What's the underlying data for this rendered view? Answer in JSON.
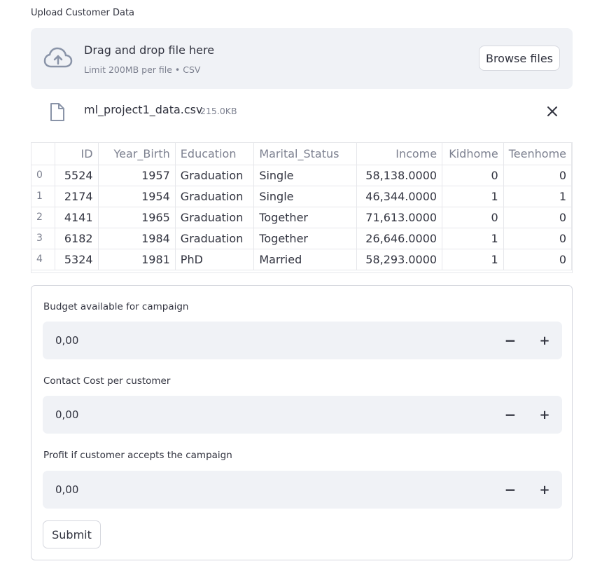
{
  "uploader": {
    "label": "Upload Customer Data",
    "drag_text": "Drag and drop file here",
    "limit_text": "Limit 200MB per file • CSV",
    "browse_label": "Browse files",
    "upload_icon": "cloud-upload-icon"
  },
  "file": {
    "name": "ml_project1_data.csv",
    "size": "215.0KB",
    "icon": "file-icon",
    "close_icon": "close-icon"
  },
  "table": {
    "columns": [
      "",
      "ID",
      "Year_Birth",
      "Education",
      "Marital_Status",
      "Income",
      "Kidhome",
      "Teenhome"
    ],
    "rows": [
      [
        "0",
        "5524",
        "1957",
        "Graduation",
        "Single",
        "58,138.0000",
        "0",
        "0"
      ],
      [
        "1",
        "2174",
        "1954",
        "Graduation",
        "Single",
        "46,344.0000",
        "1",
        "1"
      ],
      [
        "2",
        "4141",
        "1965",
        "Graduation",
        "Together",
        "71,613.0000",
        "0",
        "0"
      ],
      [
        "3",
        "6182",
        "1984",
        "Graduation",
        "Together",
        "26,646.0000",
        "1",
        "0"
      ],
      [
        "4",
        "5324",
        "1981",
        "PhD",
        "Married",
        "58,293.0000",
        "1",
        "0"
      ]
    ]
  },
  "form": {
    "fields": [
      {
        "label": "Budget available for campaign",
        "value": "0,00",
        "minus": "−",
        "plus": "+"
      },
      {
        "label": "Contact Cost per customer",
        "value": "0,00",
        "minus": "−",
        "plus": "+"
      },
      {
        "label": "Profit if customer accepts the campaign",
        "value": "0,00",
        "minus": "−",
        "plus": "+"
      }
    ],
    "submit_label": "Submit"
  }
}
